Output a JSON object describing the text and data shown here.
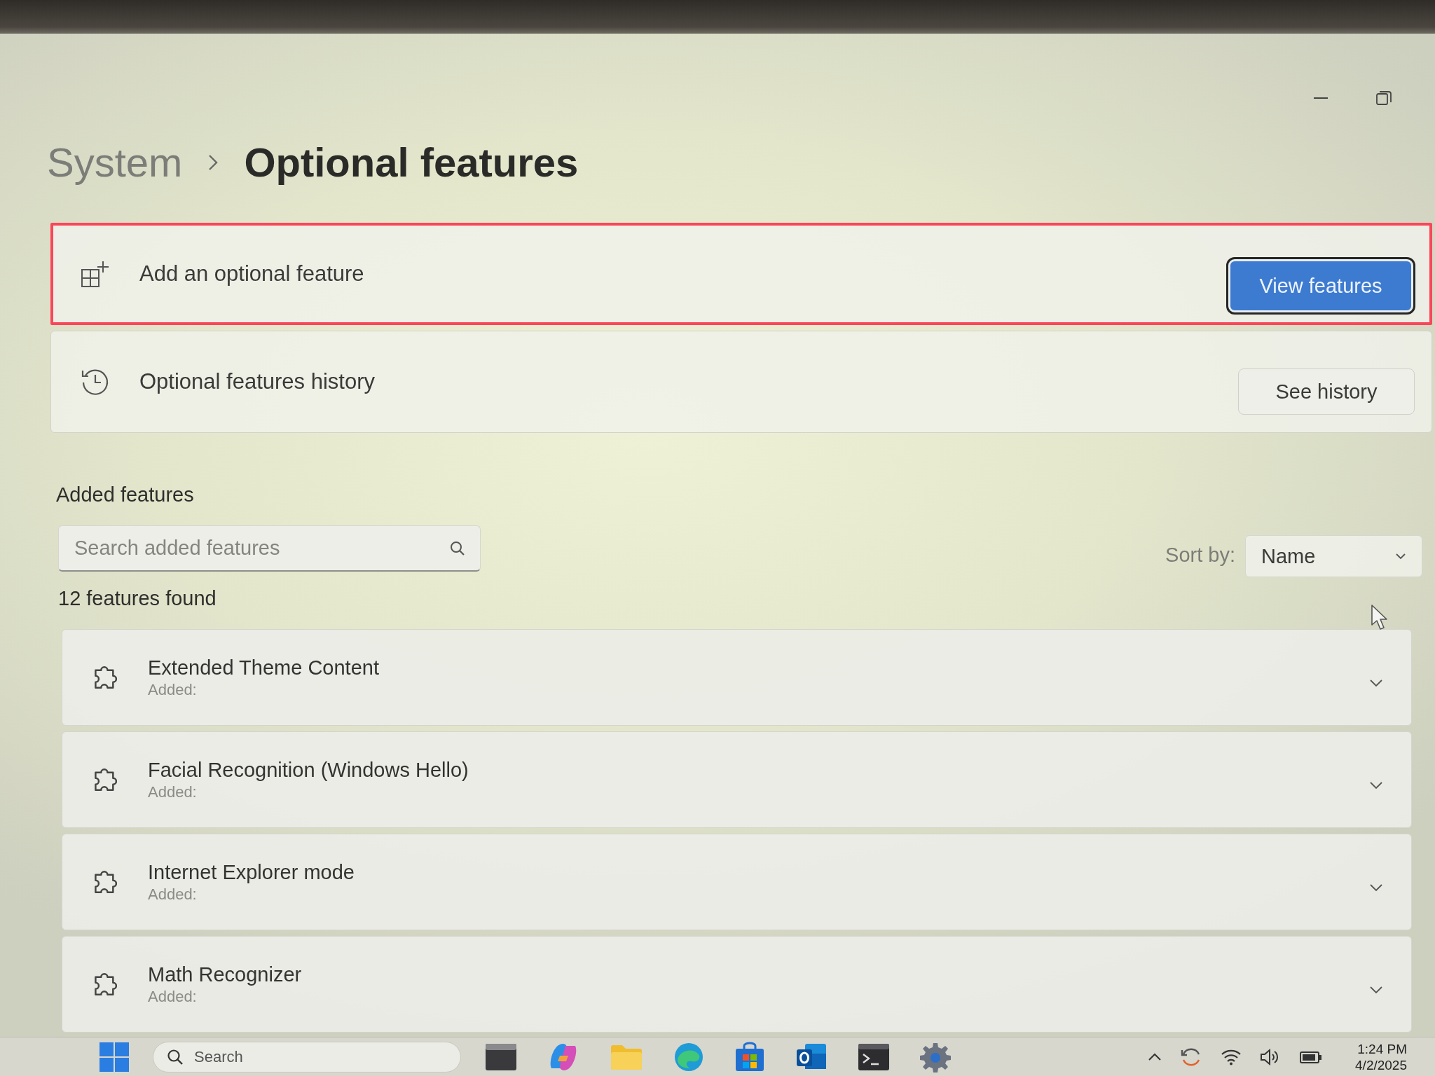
{
  "header": {
    "breadcrumb": [
      {
        "label": "System",
        "current": false
      },
      {
        "label": "Optional features",
        "current": true
      }
    ]
  },
  "actions": [
    {
      "kind": "add",
      "label": "Add an optional feature",
      "highlighted": true,
      "button": {
        "label": "View features",
        "primary": true,
        "focused": true
      }
    },
    {
      "kind": "history",
      "label": "Optional features history",
      "highlighted": false,
      "button": {
        "label": "See history",
        "primary": false,
        "focused": false
      }
    }
  ],
  "added_features": {
    "heading": "Added features",
    "search": {
      "placeholder": "Search added features"
    },
    "sort": {
      "label": "Sort by:",
      "value": "Name"
    },
    "count": "12 features found",
    "items": [
      {
        "name": "Extended Theme Content",
        "status": "Added:",
        "expanded": false
      },
      {
        "name": "Facial Recognition (Windows Hello)",
        "status": "Added:",
        "expanded": false
      },
      {
        "name": "Internet Explorer mode",
        "status": "Added:",
        "expanded": false
      },
      {
        "name": "Math Recognizer",
        "status": "Added:",
        "expanded": false
      }
    ]
  },
  "taskbar": {
    "search": {
      "placeholder": "Search"
    },
    "time": "1:24 PM",
    "date": "4/2/2025"
  }
}
